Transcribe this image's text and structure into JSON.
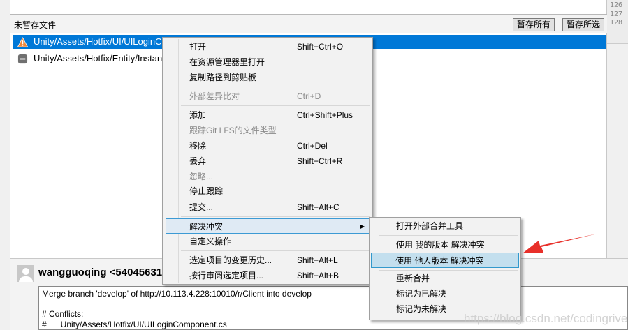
{
  "unstaged": {
    "title": "未暂存文件",
    "stage_all": "暂存所有",
    "stage_selected": "暂存所选",
    "files": [
      {
        "path": "Unity/Assets/Hotfix/UI/UILoginComponent.cs",
        "status": "conflict-warning",
        "selected": true
      },
      {
        "path": "Unity/Assets/Hotfix/Entity/Instan",
        "status": "removed",
        "selected": false
      }
    ]
  },
  "gutter_lines": [
    "126",
    "127",
    "128"
  ],
  "commit": {
    "author": "wangguoqing <54045631",
    "message": "Merge branch 'develop' of http://10.113.4.228:10010/r/Client into develop\n\n# Conflicts:\n#\tUnity/Assets/Hotfix/UI/UILoginComponent.cs"
  },
  "context_menu": [
    {
      "label": "打开",
      "shortcut": "Shift+Ctrl+O"
    },
    {
      "label": "在资源管理器里打开",
      "shortcut": ""
    },
    {
      "label": "复制路径到剪贴板",
      "shortcut": ""
    },
    {
      "label": "外部差异比对",
      "shortcut": "Ctrl+D",
      "disabled": true
    },
    {
      "label": "添加",
      "shortcut": "Ctrl+Shift+Plus"
    },
    {
      "label": "跟踪Git LFS的文件类型",
      "shortcut": "",
      "disabled": true
    },
    {
      "label": "移除",
      "shortcut": "Ctrl+Del"
    },
    {
      "label": "丢弃",
      "shortcut": "Shift+Ctrl+R"
    },
    {
      "label": "忽略...",
      "shortcut": "",
      "disabled": true
    },
    {
      "label": "停止跟踪",
      "shortcut": ""
    },
    {
      "label": "提交...",
      "shortcut": "Shift+Alt+C"
    },
    {
      "label": "解决冲突",
      "shortcut": "",
      "submenu": true,
      "highlighted": true
    },
    {
      "label": "自定义操作",
      "shortcut": ""
    },
    {
      "label": "选定项目的变更历史...",
      "shortcut": "Shift+Alt+L"
    },
    {
      "label": "按行审阅选定项目...",
      "shortcut": "Shift+Alt+B"
    }
  ],
  "submenu": [
    {
      "label": "打开外部合并工具"
    },
    {
      "label": "使用 我的版本 解决冲突"
    },
    {
      "label": "使用 他人版本 解决冲突",
      "highlighted": true
    },
    {
      "label": "重新合并"
    },
    {
      "label": "标记为已解决"
    },
    {
      "label": "标记为未解决"
    }
  ],
  "watermark": "https://blog.csdn.net/codingriver",
  "colors": {
    "selection": "#0078d7",
    "arrow": "#e8302a",
    "warning": "#f0883a"
  }
}
